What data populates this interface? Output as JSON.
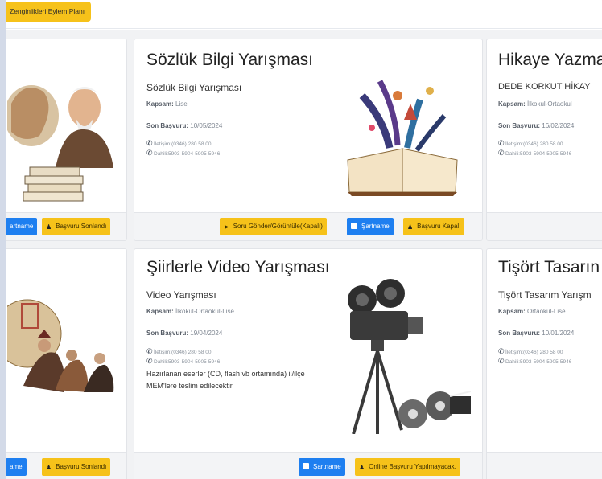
{
  "top_button": {
    "label": "Zenginlikleri Eylem Planı"
  },
  "cards": [
    {
      "footer": [
        {
          "type": "blue",
          "label": "artname"
        },
        {
          "type": "yellow",
          "label": "Başvuru Sonlandı"
        }
      ]
    },
    {
      "title": "Sözlük Bilgi Yarışması",
      "subtitle": "Sözlük Bilgi Yarışması",
      "scope_label": "Kapsam:",
      "scope": "Lise",
      "deadline_label": "Son Başvuru:",
      "deadline": "10/05/2024",
      "phone": "İletişim:(0346) 280 58 00",
      "ext": "Dahili:5903-5904-5905-5946",
      "footer": [
        {
          "type": "yellow",
          "label": "Soru Gönder/Görüntüle(Kapalı)",
          "icon": "send-icon"
        },
        {
          "type": "blue",
          "label": "Şartname",
          "icon": "document-icon"
        },
        {
          "type": "yellow",
          "label": "Başvuru Kapalı",
          "icon": "user-icon"
        }
      ]
    },
    {
      "title": "Hikaye Yazma",
      "subtitle": "DEDE KORKUT HİKAY",
      "scope_label": "Kapsam:",
      "scope": "İlkokul-Ortaokul",
      "deadline_label": "Son Başvuru:",
      "deadline": "16/02/2024",
      "phone": "İletişim:(0346) 280 58 00",
      "ext": "Dahili:5903-5904-5905-5946"
    },
    {
      "footer": [
        {
          "type": "blue",
          "label": "ame"
        },
        {
          "type": "yellow",
          "label": "Başvuru Sonlandı"
        }
      ]
    },
    {
      "title": "Şiirlerle Video Yarışması",
      "subtitle": "Video Yarışması",
      "scope_label": "Kapsam:",
      "scope": "İlkokul-Ortaokul-Lise",
      "deadline_label": "Son Başvuru:",
      "deadline": "19/04/2024",
      "phone": "İletişim:(0346) 280 58 00",
      "ext": "Dahili:5903-5904-5905-5946",
      "note": "Hazırlanan eserler (CD, flash vb ortamında) il/ilçe MEM'lere teslim edilecektir.",
      "footer": [
        {
          "type": "blue",
          "label": "Şartname",
          "icon": "document-icon"
        },
        {
          "type": "yellow",
          "label": "Online Başvuru Yapılmayacak.",
          "icon": "user-icon"
        }
      ]
    },
    {
      "title": "Tişört Tasarın",
      "subtitle": "Tişört Tasarım Yarışm",
      "scope_label": "Kapsam:",
      "scope": "Ortaokul-Lise",
      "deadline_label": "Son Başvuru:",
      "deadline": "10/01/2024",
      "phone": "İletişim:(0346) 280 58 00",
      "ext": "Dahili:5903-5904-5905-5946"
    }
  ]
}
